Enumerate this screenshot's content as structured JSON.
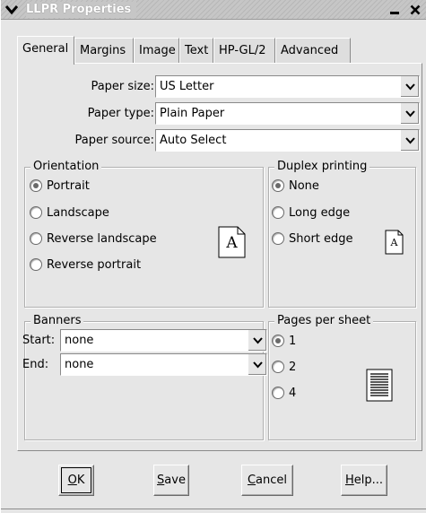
{
  "window": {
    "title": "LLPR Properties",
    "menu_icon": "chevron-down-icon",
    "minimize_icon": "minimize-icon",
    "close_icon": "close-icon"
  },
  "tabs": [
    {
      "label": "General",
      "active": true
    },
    {
      "label": "Margins",
      "active": false
    },
    {
      "label": "Image",
      "active": false
    },
    {
      "label": "Text",
      "active": false
    },
    {
      "label": "HP-GL/2",
      "active": false
    },
    {
      "label": "Advanced",
      "active": false
    }
  ],
  "paper": {
    "size_label": "Paper size:",
    "size_value": "US Letter",
    "type_label": "Paper type:",
    "type_value": "Plain Paper",
    "source_label": "Paper source:",
    "source_value": "Auto Select"
  },
  "orientation": {
    "title": "Orientation",
    "options": [
      "Portrait",
      "Landscape",
      "Reverse landscape",
      "Reverse portrait"
    ],
    "selected": "Portrait",
    "preview_letter": "A"
  },
  "duplex": {
    "title": "Duplex printing",
    "options": [
      "None",
      "Long edge",
      "Short edge"
    ],
    "selected": "None",
    "preview_letter": "A"
  },
  "banners": {
    "title": "Banners",
    "start_label": "Start:",
    "start_value": "none",
    "end_label": "End:",
    "end_value": "none"
  },
  "pages_per_sheet": {
    "title": "Pages per sheet",
    "options": [
      "1",
      "2",
      "4"
    ],
    "selected": "1"
  },
  "buttons": {
    "ok": {
      "mnemonic": "O",
      "rest": "K"
    },
    "save": {
      "mnemonic": "S",
      "rest": "ave"
    },
    "cancel": {
      "mnemonic": "C",
      "rest": "ancel"
    },
    "help": {
      "mnemonic": "H",
      "rest": "elp..."
    }
  },
  "colors": {
    "window_bg": "#e6e6e6",
    "title_text": "#ffffff",
    "radio_fill": "#6a6a6a"
  }
}
